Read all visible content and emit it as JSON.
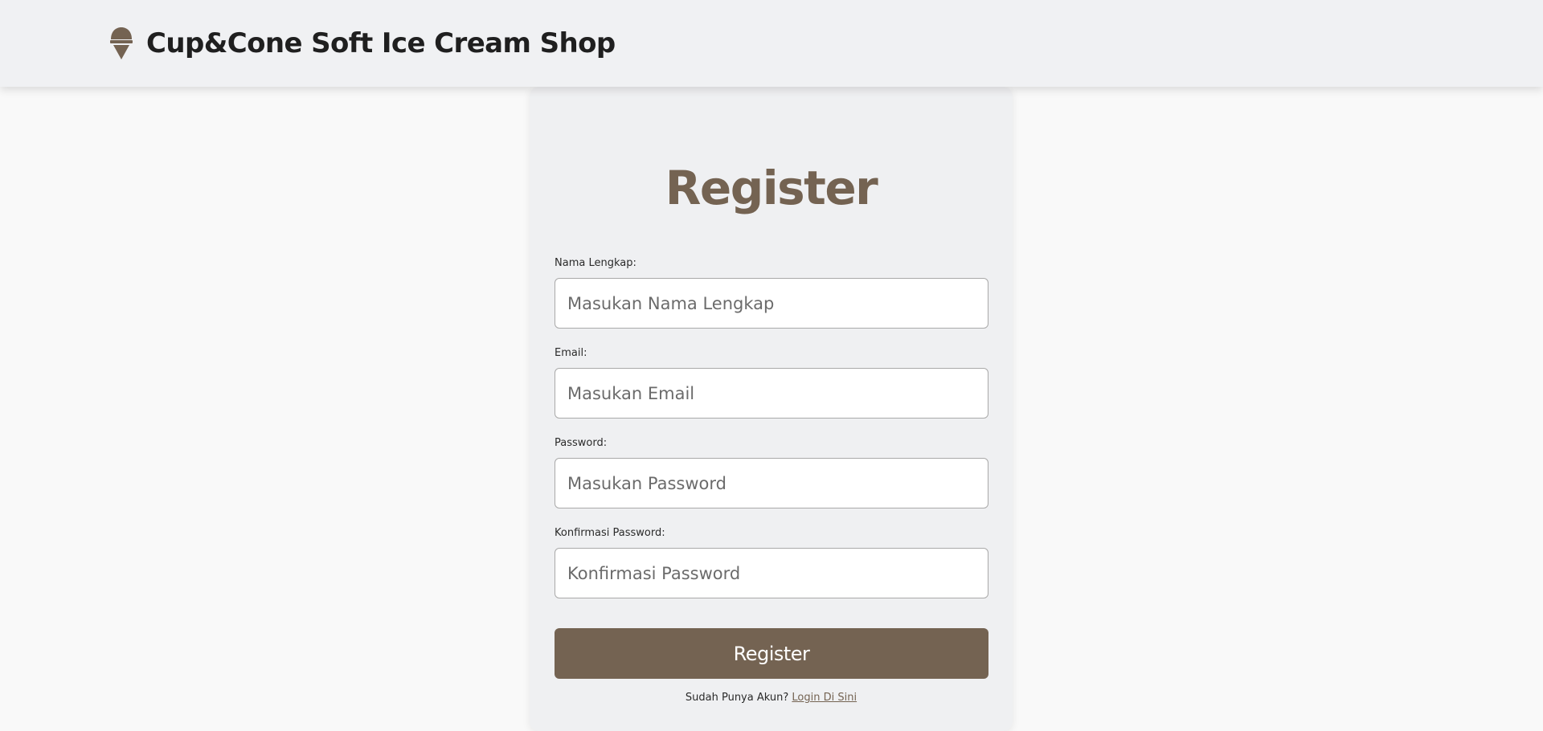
{
  "header": {
    "brand_name": "Cup&Cone Soft Ice Cream Shop",
    "brand_icon": "ice-cream-icon",
    "brand_color": "#746352"
  },
  "form": {
    "title": "Register",
    "fields": [
      {
        "label": "Nama Lengkap:",
        "placeholder": "Masukan Nama Lengkap",
        "value": ""
      },
      {
        "label": "Email:",
        "placeholder": "Masukan Email",
        "value": ""
      },
      {
        "label": "Password:",
        "placeholder": "Masukan Password",
        "value": ""
      },
      {
        "label": "Konfirmasi Password:",
        "placeholder": "Konfirmasi Password",
        "value": ""
      }
    ],
    "submit_label": "Register",
    "footer_text": "Sudah Punya Akun?",
    "footer_link": "Login Di Sini"
  }
}
